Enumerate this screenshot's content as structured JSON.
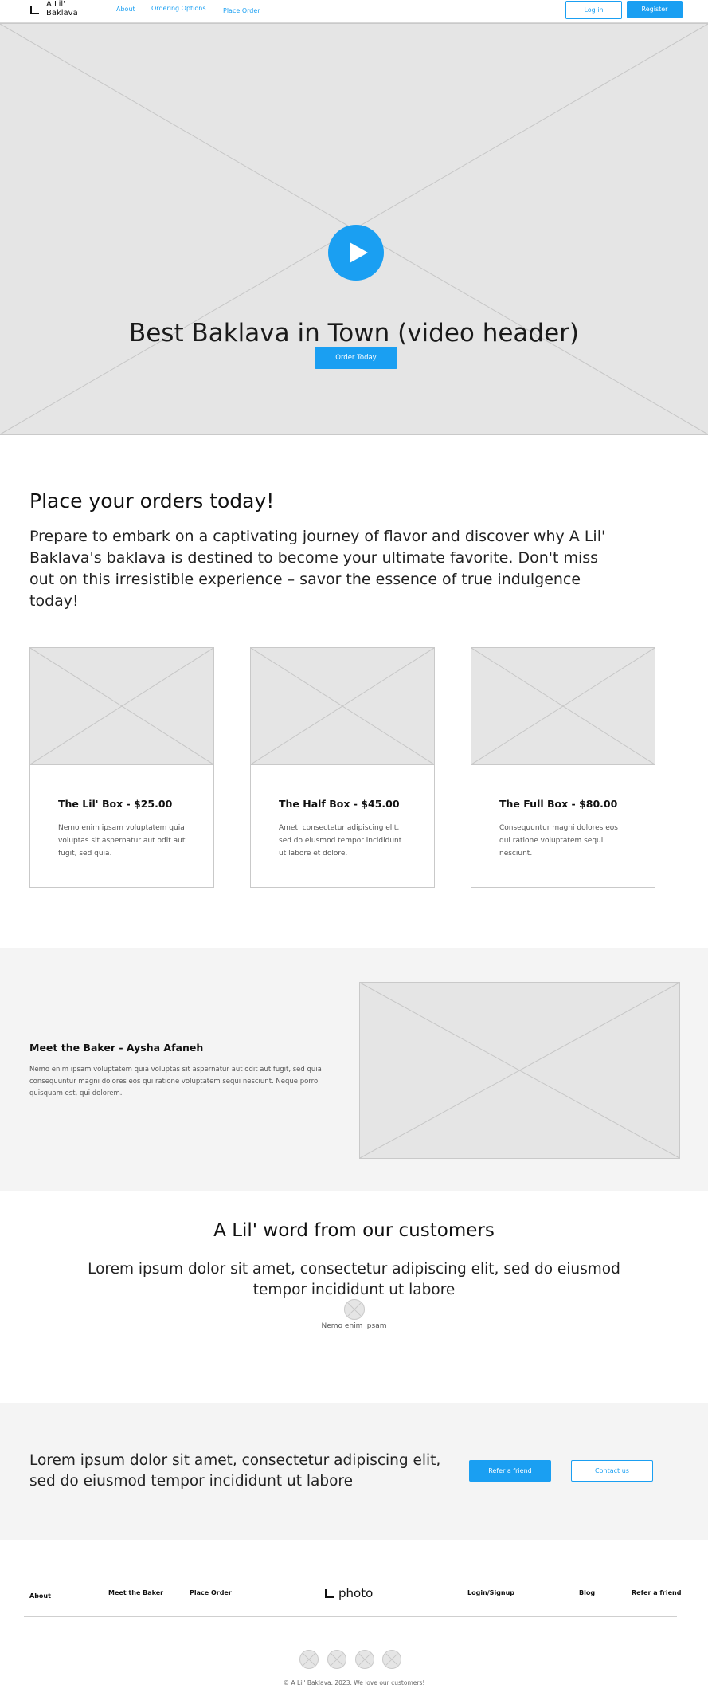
{
  "nav": {
    "logo_text": "A Lil' Baklava",
    "links": [
      "About",
      "Ordering Options",
      "Place Order"
    ],
    "login_label": "Log in",
    "register_label": "Register"
  },
  "hero": {
    "title": "Best Baklava in Town (video header)",
    "cta_label": "Order Today"
  },
  "intro": {
    "heading": "Place your orders today!",
    "body": "Prepare to embark on a captivating journey of flavor and discover why A Lil' Baklava's baklava is destined to become your ultimate favorite. Don't miss out on this irresistible experience – savor the essence of true indulgence today!"
  },
  "products": [
    {
      "title": "The Lil' Box  - $25.00",
      "description": "Nemo enim ipsam voluptatem quia voluptas sit aspernatur aut odit aut fugit, sed quia."
    },
    {
      "title": "The Half Box - $45.00",
      "description": "Amet, consectetur adipiscing elit, sed do eiusmod tempor incididunt ut labore et dolore."
    },
    {
      "title": "The Full Box - $80.00",
      "description": "Consequuntur magni dolores eos qui ratione voluptatem sequi nesciunt."
    }
  ],
  "baker": {
    "title": "Meet the Baker - Aysha Afaneh",
    "description": "Nemo enim ipsam voluptatem quia voluptas sit aspernatur aut odit aut fugit, sed quia consequuntur magni dolores eos qui ratione voluptatem sequi nesciunt. Neque porro quisquam est, qui dolorem."
  },
  "testimonial": {
    "heading": "A Lil' word from our customers",
    "quote": "Lorem ipsum dolor sit amet, consectetur adipiscing elit, sed do eiusmod tempor incididunt ut labore",
    "author": "Nemo enim ipsam"
  },
  "cta": {
    "text": "Lorem ipsum dolor sit amet, consectetur adipiscing elit, sed do eiusmod tempor incididunt ut labore",
    "refer_label": "Refer a friend",
    "contact_label": "Contact us"
  },
  "footer": {
    "links": [
      "About",
      "Meet the Baker",
      "Place Order",
      "Login/Signup",
      "Blog",
      "Refer a friend"
    ],
    "logo_text": "photo",
    "copyright": "© A Lil' Baklava. 2023. We love our customers!"
  },
  "colors": {
    "accent": "#1a9ff2",
    "placeholder": "#e5e5e5",
    "section_bg": "#f4f4f4"
  },
  "icons": {
    "play": "play-icon",
    "logo": "logo-icon",
    "social": "image-placeholder-icon"
  }
}
